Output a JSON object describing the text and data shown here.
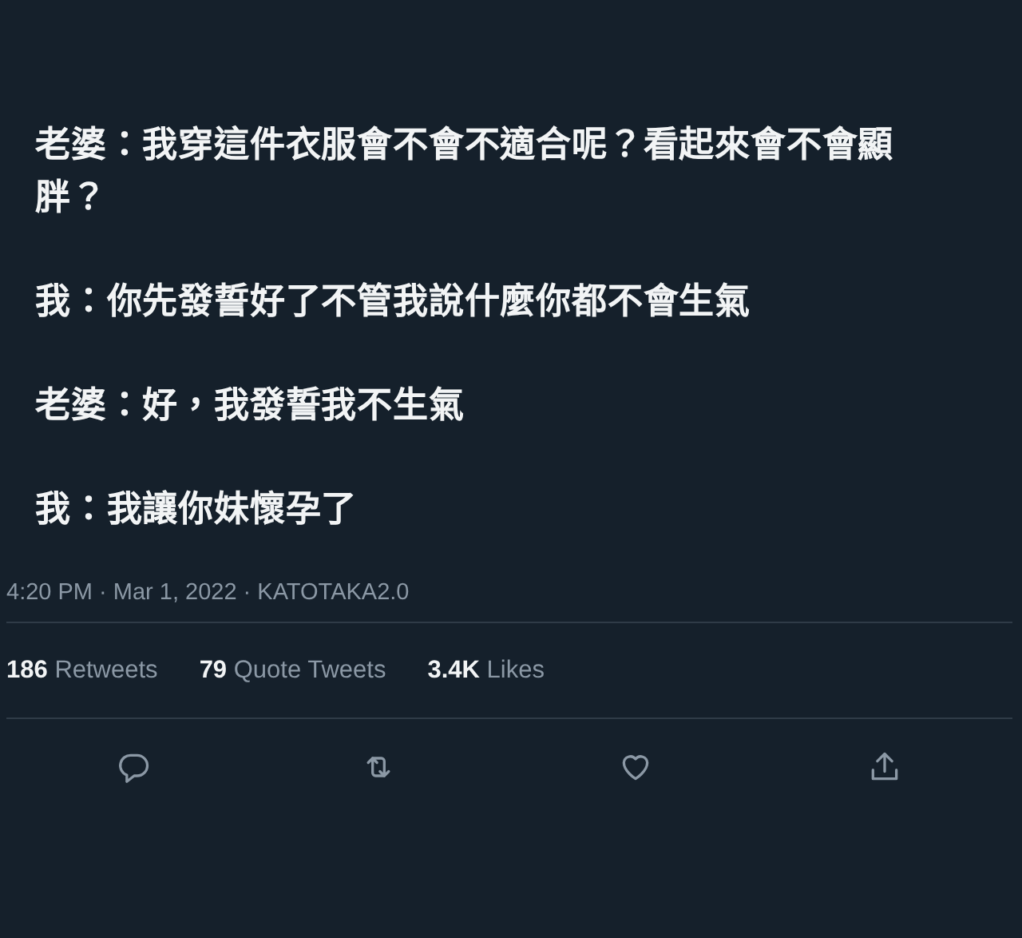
{
  "tweet": {
    "paragraphs": [
      "老婆：我穿這件衣服會不會不適合呢？看起來會不會顯胖？",
      "我：你先發誓好了不管我說什麼你都不會生氣",
      "老婆：好，我發誓我不生氣",
      "我：我讓你妹懷孕了"
    ],
    "meta": "4:20 PM · Mar 1, 2022 · KATOTAKA2.0"
  },
  "stats": [
    {
      "count": "186",
      "label": "Retweets"
    },
    {
      "count": "79",
      "label": "Quote Tweets"
    },
    {
      "count": "3.4K",
      "label": "Likes"
    }
  ],
  "actions": [
    {
      "kind": "reply"
    },
    {
      "kind": "retweet"
    },
    {
      "kind": "like"
    },
    {
      "kind": "share"
    }
  ]
}
